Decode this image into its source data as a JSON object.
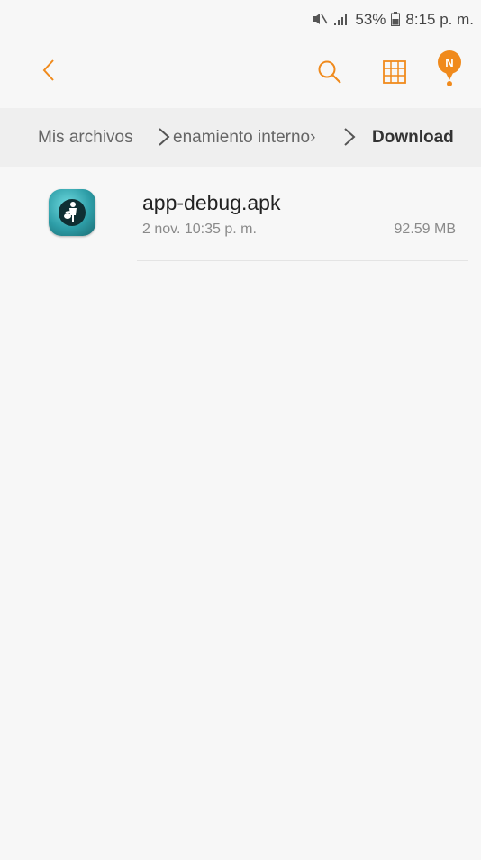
{
  "status_bar": {
    "battery": "53%",
    "time": "8:15 p. m."
  },
  "toolbar": {
    "icons": [
      "back-icon",
      "search-icon",
      "grid-view-icon",
      "notification-icon"
    ],
    "notification_badge": "N",
    "accent": "#f08a1c"
  },
  "breadcrumb": {
    "items": [
      "Mis archivos",
      "Almacenamiento interno",
      "Download"
    ],
    "visible_item_2": "‹enamiento interno"
  },
  "files": [
    {
      "name": "app-debug.apk",
      "date": "2 nov. 10:35 p. m.",
      "size": "92.59 MB",
      "icon": "apk-app-icon"
    }
  ]
}
